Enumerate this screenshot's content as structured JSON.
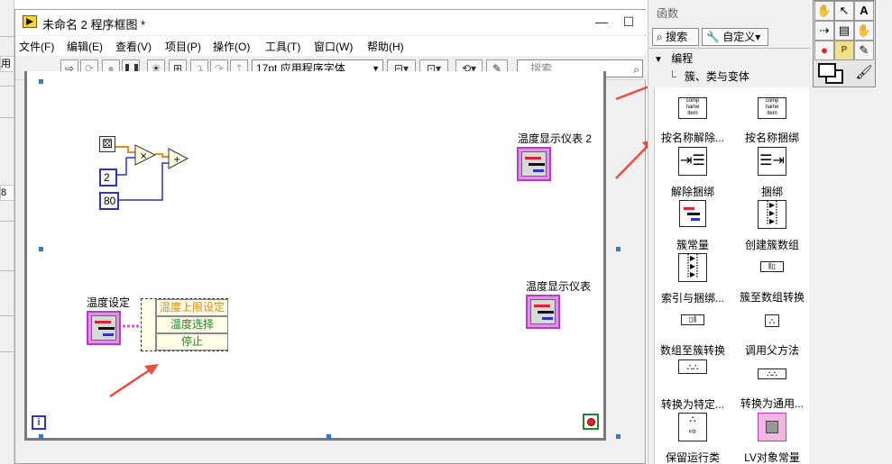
{
  "window": {
    "title": "未命名 2 程序框图 *",
    "controls": [
      "—",
      "☐",
      "✕"
    ]
  },
  "menu": [
    "文件(F)",
    "编辑(E)",
    "查看(V)",
    "项目(P)",
    "操作(O)",
    "工具(T)",
    "窗口(W)",
    "帮助(H)"
  ],
  "toolbar": {
    "font": "17pt 应用程序字体",
    "search_placeholder": "搜索",
    "icons": [
      "run-arrow-icon",
      "run-continuous-icon",
      "abort-icon",
      "pause-icon",
      "highlight-execution-icon",
      "retain-wire-values-icon",
      "step-into-icon",
      "step-over-icon",
      "step-out-icon",
      "align-icon",
      "distribute-icon",
      "reorder-icon",
      "cleanup-icon"
    ]
  },
  "background_window": {
    "labels": [
      "用村",
      "8"
    ]
  },
  "diagram": {
    "labels": {
      "gauge2": "温度显示仪表 2",
      "gauge1": "温度显示仪表",
      "temp_setting": "温度设定"
    },
    "constants": [
      "2",
      "80"
    ],
    "enum_items": [
      "温度上限设定",
      "温度选择",
      "停止"
    ],
    "enum_colors": [
      "#e8891a",
      "#1e8a2c",
      "#1e8a2c"
    ],
    "info_icon": "i"
  },
  "palette": {
    "title": "函数",
    "search_label": "搜索",
    "custom_label": "自定义▾",
    "tree_root": "编程",
    "tree_child": "簇、类与变体",
    "items": [
      {
        "label": "按名称解除...",
        "icon": "unbundle-by-name-icon"
      },
      {
        "label": "按名称捆绑",
        "icon": "bundle-by-name-icon"
      },
      {
        "label": "解除捆绑",
        "icon": "unbundle-icon"
      },
      {
        "label": "捆绑",
        "icon": "bundle-icon"
      },
      {
        "label": "簇常量",
        "icon": "cluster-constant-icon"
      },
      {
        "label": "创建簇数组",
        "icon": "build-cluster-array-icon"
      },
      {
        "label": "索引与捆绑...",
        "icon": "index-and-bundle-icon"
      },
      {
        "label": "簇至数组转换",
        "icon": "cluster-to-array-icon"
      },
      {
        "label": "数组至簇转换",
        "icon": "array-to-cluster-icon"
      },
      {
        "label": "调用父方法",
        "icon": "call-parent-method-icon"
      },
      {
        "label": "转换为特定...",
        "icon": "to-more-specific-class-icon"
      },
      {
        "label": "转换为通用...",
        "icon": "to-more-generic-class-icon"
      },
      {
        "label": "保留运行类",
        "icon": "preserve-run-time-class-icon"
      },
      {
        "label": "LV对象常量",
        "icon": "lv-object-constant-icon"
      }
    ]
  },
  "tools": {
    "cells": [
      "✋",
      "↖",
      "A",
      "⇢",
      "▤",
      "✋",
      "●",
      "P",
      "✎"
    ],
    "icons": [
      "operate-value-icon",
      "position-select-icon",
      "edit-text-icon",
      "connect-wire-icon",
      "object-shortcut-icon",
      "scroll-icon",
      "breakpoint-icon",
      "probe-icon",
      "get-color-icon"
    ]
  },
  "colors": {
    "cluster_pink": "#e68cf0",
    "const_blue": "#2a35c8",
    "annotation_red": "#ef4b3a",
    "wire_orange": "#e88b1f",
    "wire_blue": "#2a35c8",
    "wire_pink": "#d957d8"
  }
}
